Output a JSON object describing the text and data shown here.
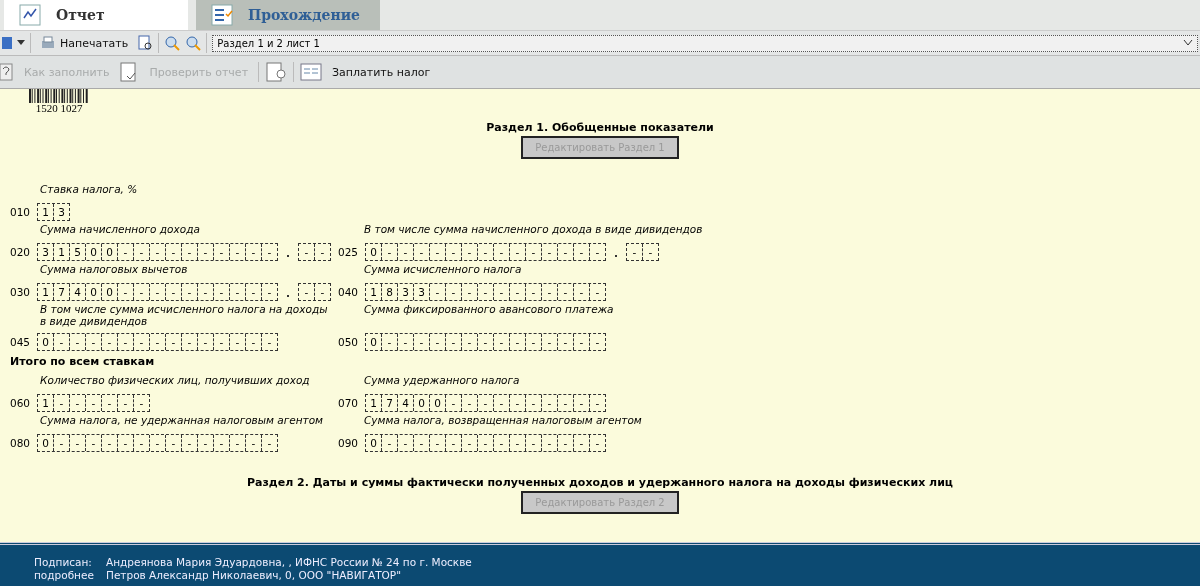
{
  "tabs": [
    {
      "label": "Отчет",
      "selected": true
    },
    {
      "label": "Прохождение",
      "selected": false
    }
  ],
  "toolbar": {
    "print_label": "Напечатать",
    "page_select": "Раздел 1 и 2 лист 1"
  },
  "actions": [
    {
      "label": "Как заполнить",
      "disabled": true
    },
    {
      "label": "Проверить отчет",
      "disabled": true
    },
    {
      "label": "Заплатить налог",
      "disabled": false
    }
  ],
  "barcode": {
    "number": "1520 1027"
  },
  "section1": {
    "title": "Раздел 1. Обобщенные показатели",
    "button": "Редактировать Раздел 1"
  },
  "rows": [
    {
      "left": {
        "code": "010",
        "label": "Ставка налога, %",
        "cells": [
          "1",
          "3"
        ]
      },
      "right": null
    },
    {
      "left": {
        "code": "020",
        "label": "Сумма начисленного дохода",
        "cells": [
          "3",
          "1",
          "5",
          "0",
          "0",
          "-",
          "-",
          "-",
          "-",
          "-",
          "-",
          "-",
          "-",
          "-",
          "-"
        ],
        "decimals": [
          "-",
          "-"
        ]
      },
      "right": {
        "code": "025",
        "label": "В том числе сумма начисленного дохода в виде дивидендов",
        "cells": [
          "0",
          "-",
          "-",
          "-",
          "-",
          "-",
          "-",
          "-",
          "-",
          "-",
          "-",
          "-",
          "-",
          "-",
          "-"
        ],
        "decimals": [
          "-",
          "-"
        ]
      }
    },
    {
      "left": {
        "code": "030",
        "label": "Сумма налоговых вычетов",
        "cells": [
          "1",
          "7",
          "4",
          "0",
          "0",
          "-",
          "-",
          "-",
          "-",
          "-",
          "-",
          "-",
          "-",
          "-",
          "-"
        ],
        "decimals": [
          "-",
          "-"
        ]
      },
      "right": {
        "code": "040",
        "label": "Сумма исчисленного налога",
        "cells": [
          "1",
          "8",
          "3",
          "3",
          "-",
          "-",
          "-",
          "-",
          "-",
          "-",
          "-",
          "-",
          "-",
          "-",
          "-"
        ]
      }
    },
    {
      "left": {
        "code": "045",
        "label": "В том числе сумма исчисленного налога на доходы в виде дивидендов",
        "cells": [
          "0",
          "-",
          "-",
          "-",
          "-",
          "-",
          "-",
          "-",
          "-",
          "-",
          "-",
          "-",
          "-",
          "-",
          "-"
        ]
      },
      "right": {
        "code": "050",
        "label": "Сумма фиксированного авансового платежа",
        "cells": [
          "0",
          "-",
          "-",
          "-",
          "-",
          "-",
          "-",
          "-",
          "-",
          "-",
          "-",
          "-",
          "-",
          "-",
          "-"
        ]
      }
    }
  ],
  "totals_heading": "Итого по всем ставкам",
  "total_rows": [
    {
      "left": {
        "code": "060",
        "label": "Количество физических лиц, получивших доход",
        "cells": [
          "1",
          "-",
          "-",
          "-",
          "-",
          "-",
          "-"
        ]
      },
      "right": {
        "code": "070",
        "label": "Сумма удержанного налога",
        "cells": [
          "1",
          "7",
          "4",
          "0",
          "0",
          "-",
          "-",
          "-",
          "-",
          "-",
          "-",
          "-",
          "-",
          "-",
          "-"
        ]
      }
    },
    {
      "left": {
        "code": "080",
        "label": "Сумма налога, не удержанная налоговым агентом",
        "cells": [
          "0",
          "-",
          "-",
          "-",
          "-",
          "-",
          "-",
          "-",
          "-",
          "-",
          "-",
          "-",
          "-",
          "-",
          "-"
        ]
      },
      "right": {
        "code": "090",
        "label": "Сумма налога, возвращенная налоговым агентом",
        "cells": [
          "0",
          "-",
          "-",
          "-",
          "-",
          "-",
          "-",
          "-",
          "-",
          "-",
          "-",
          "-",
          "-",
          "-",
          "-"
        ]
      }
    }
  ],
  "section2": {
    "title": "Раздел 2. Даты и суммы фактически полученных доходов и удержанного налога на доходы физических лиц",
    "button": "Редактировать Раздел 2"
  },
  "footer": [
    {
      "label": "Подписан:",
      "value": "Андреянова Мария Эдуардовна, , ИФНС России № 24 по г. Москве"
    },
    {
      "label": "подробнее",
      "value": "Петров Александр Николаевич, 0, ООО \"НАВИГАТОР\""
    }
  ]
}
